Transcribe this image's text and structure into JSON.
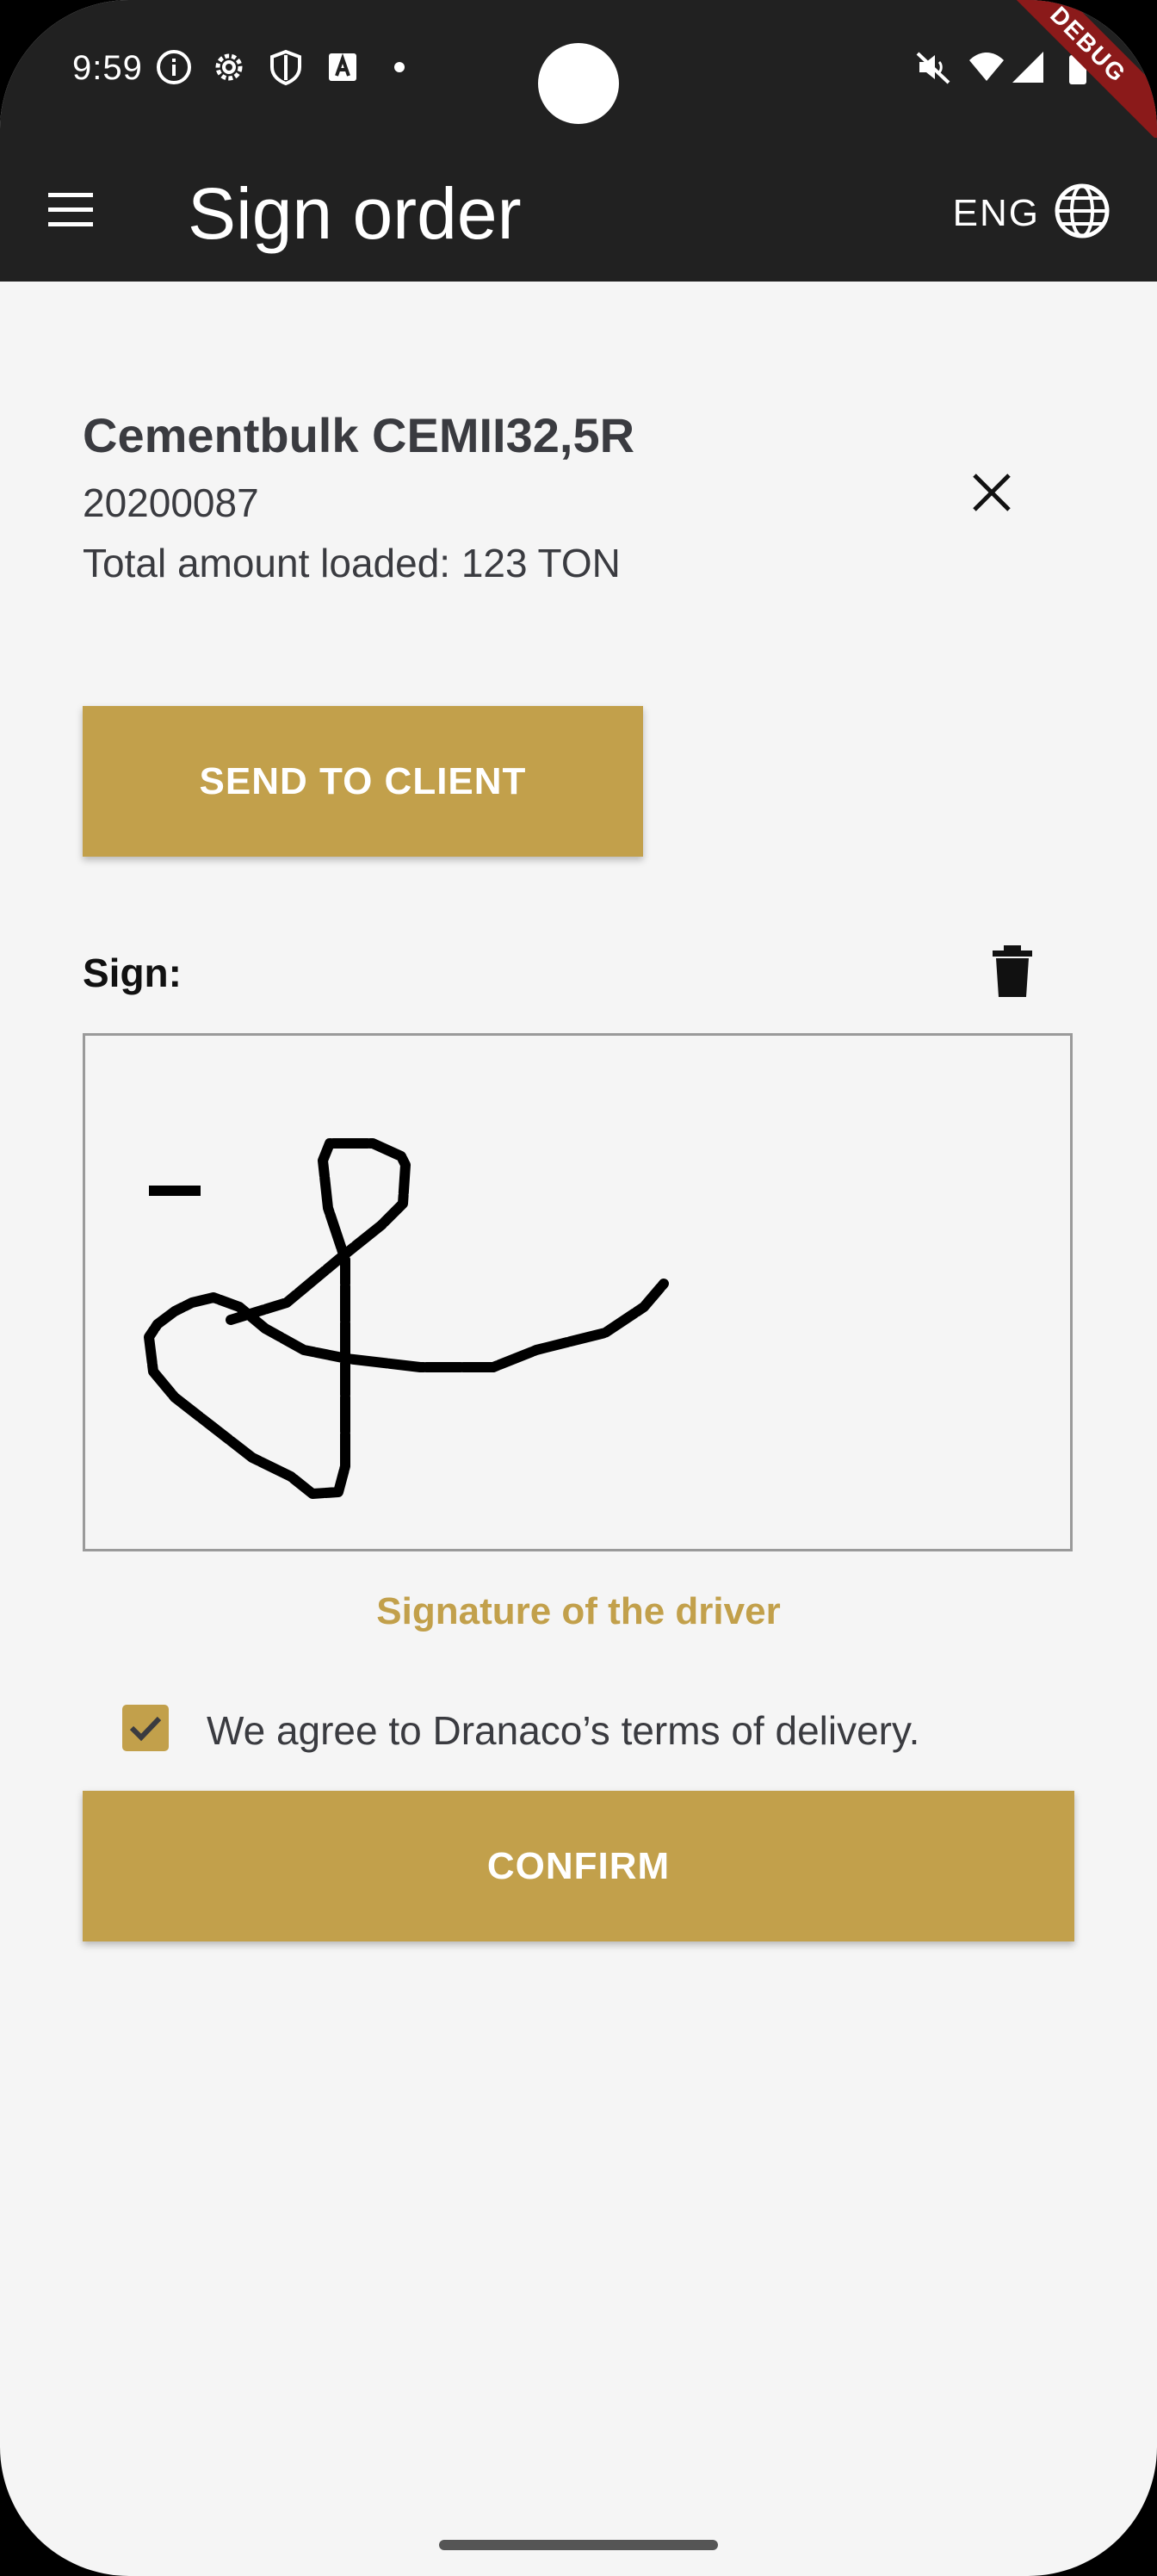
{
  "status_bar": {
    "time": "9:59",
    "left_icons": [
      "info-icon",
      "settings-icon",
      "shield-icon",
      "a-icon",
      "dot-icon"
    ],
    "right_icons": [
      "mute-icon",
      "wifi-icon",
      "signal-icon",
      "battery-icon"
    ],
    "debug_badge": "DEBUG"
  },
  "app_bar": {
    "title": "Sign order",
    "language": "ENG",
    "menu_icon": "menu-icon",
    "language_icon": "globe-icon"
  },
  "order": {
    "product_name": "Cementbulk CEMII32,5R",
    "order_number": "20200087",
    "total_loaded": "Total amount loaded: 123 TON"
  },
  "actions": {
    "send_to_client_label": "SEND TO CLIENT",
    "confirm_label": "CONFIRM"
  },
  "signature": {
    "label": "Sign:",
    "caption": "Signature of the driver"
  },
  "terms": {
    "checked": true,
    "text": "We agree to Dranaco’s terms of delivery."
  },
  "colors": {
    "accent": "#c2a04b",
    "app_bar": "#212121",
    "background": "#f5f5f5",
    "text": "#3a3b40"
  }
}
